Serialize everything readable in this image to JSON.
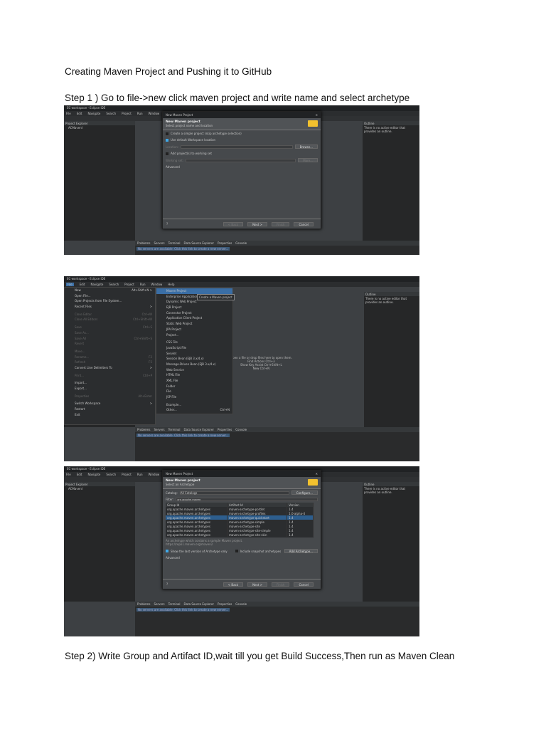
{
  "doc": {
    "title": "Creating Maven Project and Pushing it to GitHub",
    "step1": "Step 1 ) Go to file->new click maven project and write name and select archetype",
    "step2": "Step 2)  Write Group and Artifact ID,wait till you get Build Success,Then run as Maven Clean"
  },
  "eclipse": {
    "window_title": "EC-workspace - Eclipse IDE",
    "menu": [
      "File",
      "Edit",
      "Navigate",
      "Search",
      "Project",
      "Run",
      "Window",
      "Help"
    ],
    "project_explorer": "Project Explorer",
    "project_item": "ACMavenI",
    "outline_tab": "Outline",
    "outline_text": "There is no active editor that provides an outline.",
    "bottom_tabs": [
      "Problems",
      "Servers",
      "Terminal",
      "Data Source Explorer",
      "Properties",
      "Console"
    ],
    "servers_link": "No servers are available. Click this link to create a new server...",
    "editor_hints": [
      "Open a file or drop files here to open them.",
      "Find Actions Ctrl+3",
      "Show Key Assist Ctrl+Shift+L",
      "New Ctrl+N"
    ]
  },
  "dialog1": {
    "window_title": "New Maven Project",
    "heading": "New Maven project",
    "subheading": "Select project name and location",
    "simple_project": "Create a simple project (skip archetype selection)",
    "default_location": "Use default Workspace location",
    "location_label": "Location:",
    "browse": "Browse...",
    "working_set": "Add project(s) to working set",
    "working_set_label": "Working set:",
    "more": "More...",
    "advanced": "Advanced",
    "back": "< Back",
    "next": "Next >",
    "finish": "Finish",
    "cancel": "Cancel"
  },
  "file_menu": {
    "items": [
      {
        "label": "New",
        "shortcut": "Alt+Shift+N >"
      },
      {
        "label": "Open File...",
        "shortcut": ""
      },
      {
        "label": "Open Projects from File System...",
        "shortcut": ""
      },
      {
        "label": "Recent Files",
        "shortcut": ">"
      },
      {
        "label": "Close Editor",
        "shortcut": "Ctrl+W"
      },
      {
        "label": "Close All Editors",
        "shortcut": "Ctrl+Shift+W"
      },
      {
        "label": "Save",
        "shortcut": "Ctrl+S"
      },
      {
        "label": "Save As...",
        "shortcut": ""
      },
      {
        "label": "Save All",
        "shortcut": "Ctrl+Shift+S"
      },
      {
        "label": "Revert",
        "shortcut": ""
      },
      {
        "label": "Move...",
        "shortcut": ""
      },
      {
        "label": "Rename...",
        "shortcut": "F2"
      },
      {
        "label": "Refresh",
        "shortcut": "F5"
      },
      {
        "label": "Convert Line Delimiters To",
        "shortcut": ">"
      },
      {
        "label": "Print...",
        "shortcut": "Ctrl+P"
      },
      {
        "label": "Import...",
        "shortcut": ""
      },
      {
        "label": "Export...",
        "shortcut": ""
      },
      {
        "label": "Properties",
        "shortcut": "Alt+Enter"
      },
      {
        "label": "Switch Workspace",
        "shortcut": ">"
      },
      {
        "label": "Restart",
        "shortcut": ""
      },
      {
        "label": "Exit",
        "shortcut": ""
      }
    ]
  },
  "new_submenu": {
    "items": [
      "Maven Project",
      "Enterprise Application Project",
      "Dynamic Web Project",
      "EJB Project",
      "Connector Project",
      "Application Client Project",
      "Static Web Project",
      "JPA Project",
      "Project...",
      "CSS File",
      "JavaScript File",
      "Servlet",
      "Session Bean (EJB 3.x/4.x)",
      "Message-Driven Bean (EJB 3.x/4.x)",
      "Web Service",
      "HTML File",
      "XML File",
      "Folder",
      "File",
      "JSP File",
      "Example...",
      "Other..."
    ],
    "other_shortcut": "Ctrl+N",
    "tooltip": "Create a Maven project"
  },
  "dialog2": {
    "window_title": "New Maven Project",
    "heading": "New Maven project",
    "subheading": "Select an Archetype",
    "catalog_label": "Catalog:",
    "catalog_value": "All Catalogs",
    "configure": "Configure...",
    "filter_label": "Filter:",
    "filter_value": "org.apache.maven",
    "columns": [
      "Group Id",
      "Artifact Id",
      "Version"
    ],
    "rows": [
      [
        "org.apache.maven.archetypes",
        "maven-archetype-portlet",
        "1.4"
      ],
      [
        "org.apache.maven.archetypes",
        "maven-archetype-profiles",
        "1.0-alpha-4"
      ],
      [
        "org.apache.maven.archetypes",
        "maven-archetype-quickstart",
        "1.4"
      ],
      [
        "org.apache.maven.archetypes",
        "maven-archetype-simple",
        "1.4"
      ],
      [
        "org.apache.maven.archetypes",
        "maven-archetype-site",
        "1.4"
      ],
      [
        "org.apache.maven.archetypes",
        "maven-archetype-site-simple",
        "1.4"
      ],
      [
        "org.apache.maven.archetypes",
        "maven-archetype-site-skin",
        "1.4"
      ]
    ],
    "description": "An archetype which contains a sample Maven project.",
    "url": "https://repo1.maven.org/maven2",
    "last_version": "Show the last version of Archetype only",
    "snapshot": "Include snapshot archetypes",
    "add_archetype": "Add Archetype...",
    "advanced": "Advanced",
    "back": "< Back",
    "next": "Next >",
    "finish": "Finish",
    "cancel": "Cancel"
  }
}
